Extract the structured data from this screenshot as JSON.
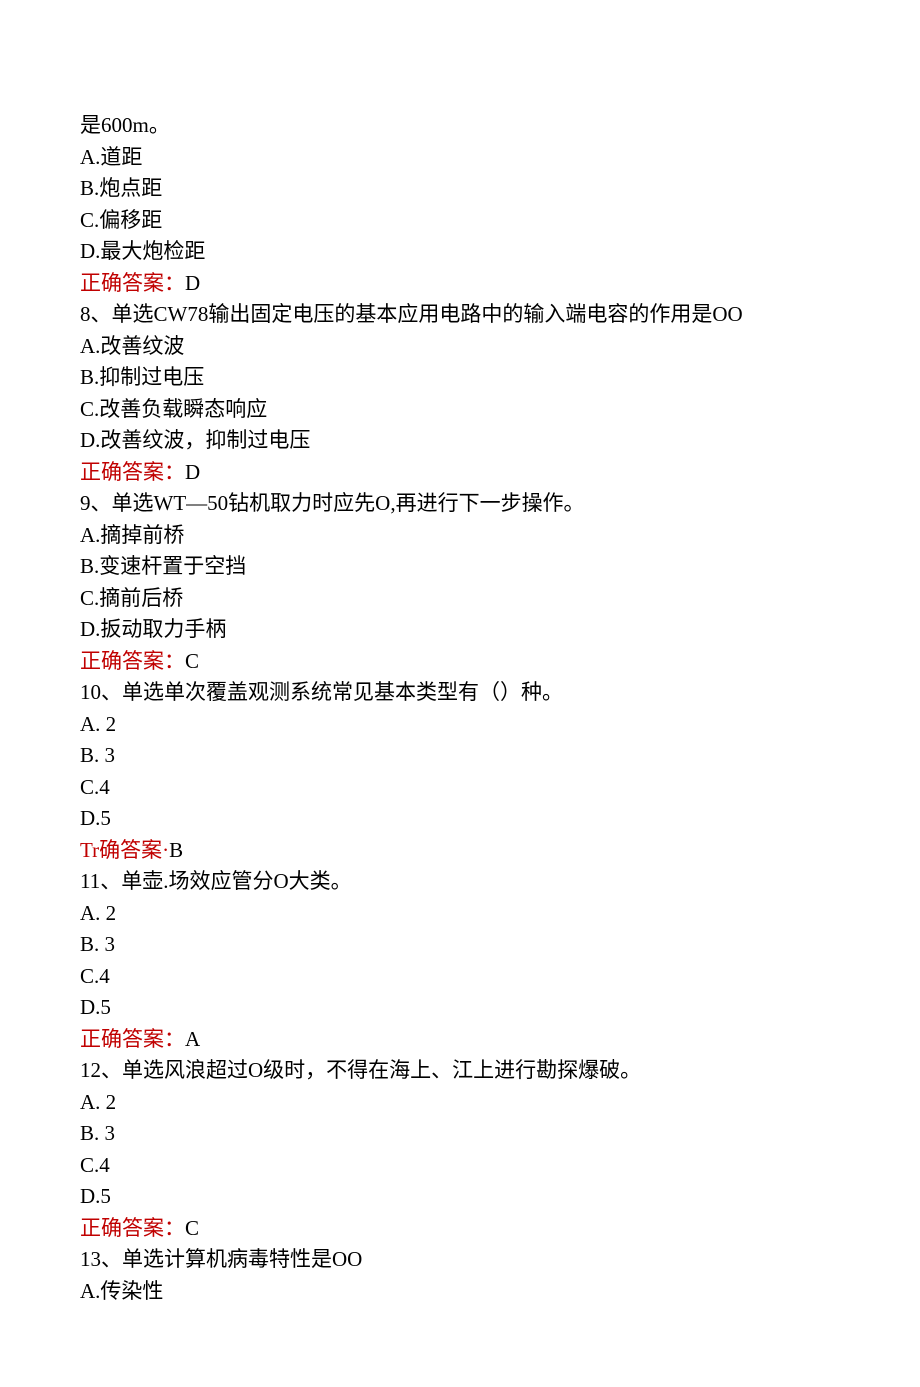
{
  "lines": [
    {
      "text": "是600m。"
    },
    {
      "text": "A.道距"
    },
    {
      "text": "B.炮点距"
    },
    {
      "text": "C.偏移距"
    },
    {
      "text": "D.最大炮检距"
    },
    {
      "answer_label": "正确答案：",
      "answer_value": "D"
    },
    {
      "text": "8、单选CW78输出固定电压的基本应用电路中的输入端电容的作用是OO"
    },
    {
      "text": "A.改善纹波"
    },
    {
      "text": "B.抑制过电压"
    },
    {
      "text": "C.改善负载瞬态响应"
    },
    {
      "text": "D.改善纹波，抑制过电压"
    },
    {
      "answer_label": "正确答案：",
      "answer_value": "D"
    },
    {
      "text": "9、单选WT—50钻机取力时应先O,再进行下一步操作。"
    },
    {
      "text": "A.摘掉前桥"
    },
    {
      "text": "B.变速杆置于空挡"
    },
    {
      "text": "C.摘前后桥"
    },
    {
      "text": "D.扳动取力手柄"
    },
    {
      "answer_label": "正确答案：",
      "answer_value": "C"
    },
    {
      "text": "10、单选单次覆盖观测系统常见基本类型有（）种。"
    },
    {
      "text": "A. 2"
    },
    {
      "text": "B. 3"
    },
    {
      "text": "C.4"
    },
    {
      "text": "D.5"
    },
    {
      "answer_label": "Tr确答案·",
      "answer_value": "B"
    },
    {
      "text": "11、单壶.场效应管分O大类。"
    },
    {
      "text": "A. 2"
    },
    {
      "text": "B. 3"
    },
    {
      "text": "C.4"
    },
    {
      "text": "D.5"
    },
    {
      "answer_label": "正确答案：",
      "answer_value": "A"
    },
    {
      "text": "12、单选风浪超过O级时，不得在海上、江上进行勘探爆破。"
    },
    {
      "text": "A. 2"
    },
    {
      "text": "B. 3"
    },
    {
      "text": "C.4"
    },
    {
      "text": "D.5"
    },
    {
      "answer_label": "正确答案：",
      "answer_value": "C"
    },
    {
      "text": "13、单选计算机病毒特性是OO"
    },
    {
      "text": "A.传染性"
    }
  ]
}
